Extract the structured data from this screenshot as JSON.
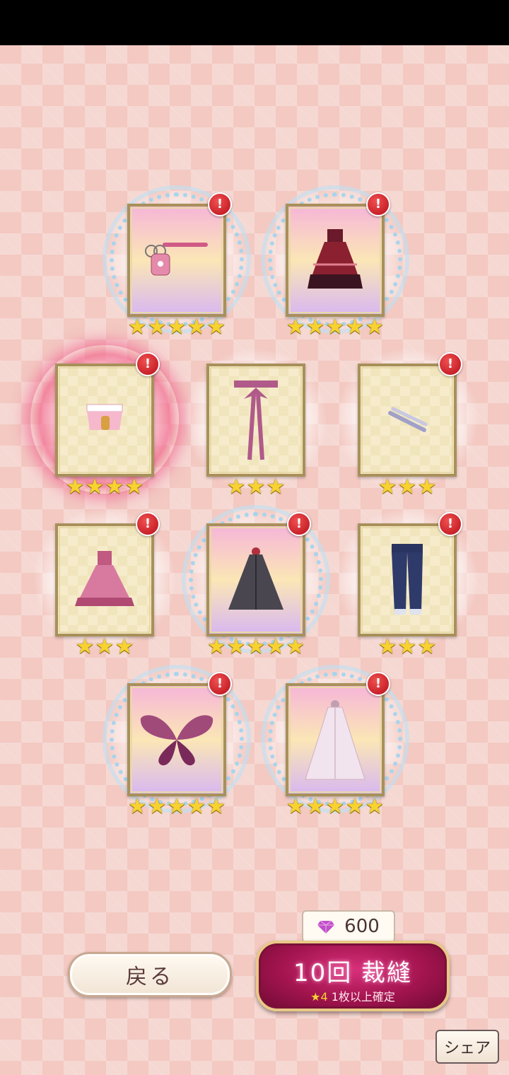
{
  "items": [
    {
      "name": "pink-bag",
      "rarity": 5,
      "new_badge": "!"
    },
    {
      "name": "gothic-dress",
      "rarity": 5,
      "new_badge": "!"
    },
    {
      "name": "lace-cuffs",
      "rarity": 4,
      "new_badge": "!"
    },
    {
      "name": "ribbon-sash",
      "rarity": 3,
      "new_badge": ""
    },
    {
      "name": "silver-bracelets",
      "rarity": 3,
      "new_badge": "!"
    },
    {
      "name": "pink-gown",
      "rarity": 3,
      "new_badge": "!"
    },
    {
      "name": "dark-cape",
      "rarity": 5,
      "new_badge": "!"
    },
    {
      "name": "denim-pants",
      "rarity": 3,
      "new_badge": "!"
    },
    {
      "name": "butterfly-wings",
      "rarity": 5,
      "new_badge": "!"
    },
    {
      "name": "bridal-veil",
      "rarity": 5,
      "new_badge": "!"
    }
  ],
  "footer": {
    "back_label": "戻る",
    "cost_value": "600",
    "sew_label": "10回 裁縫",
    "sew_sub_star": "★4",
    "sew_sub_text": "1枚以上確定",
    "share_label": "シェア"
  },
  "colors": {
    "star": "#f7d230",
    "badge": "#c8141e",
    "accent": "#a2144e"
  }
}
